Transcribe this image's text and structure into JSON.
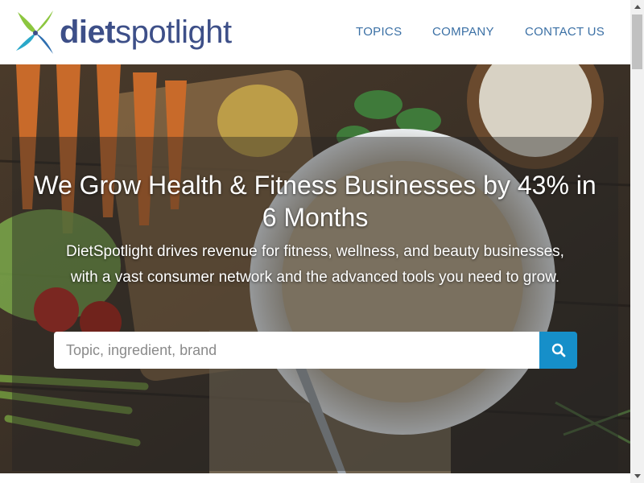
{
  "header": {
    "logo": {
      "part1": "diet",
      "part2": "spotlight"
    },
    "nav": [
      {
        "label": "TOPICS"
      },
      {
        "label": "COMPANY"
      },
      {
        "label": "CONTACT US"
      }
    ]
  },
  "hero": {
    "headline": "We Grow Health & Fitness Businesses by 43% in 6 Months",
    "subhead": "DietSpotlight drives revenue for fitness, wellness, and beauty businesses, with a vast consumer network and the advanced tools you need to grow.",
    "search": {
      "placeholder": "Topic, ingredient, brand",
      "value": ""
    },
    "search_button_icon": "search-icon"
  },
  "colors": {
    "brand_blue": "#3d4f88",
    "nav_link": "#3b70a5",
    "search_button": "#168fc9",
    "logo_green": "#8cc63f",
    "logo_teal": "#2aa8c9"
  }
}
